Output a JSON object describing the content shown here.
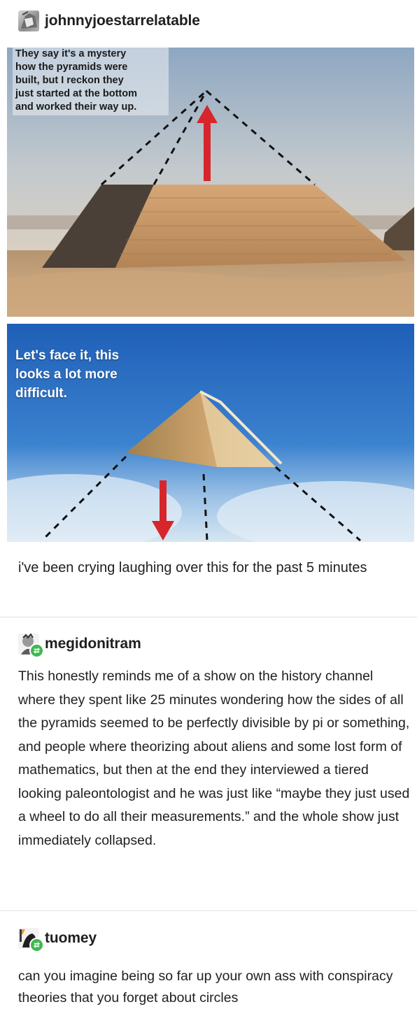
{
  "post": {
    "author": "johnnyjoestarrelatable",
    "image_top_caption": "They say it's a mystery\nhow the pyramids were\nbuilt, but I reckon they\njust started at the bottom\nand worked their way up.",
    "image_bottom_caption": "Let's face it, this\nlooks a lot more\ndifficult.",
    "body": "i've been crying laughing over this for the past 5 minutes"
  },
  "reblogs": [
    {
      "author": "megidonitram",
      "body": "This honestly reminds me of a show on the history channel where they spent like 25 minutes wondering how the sides of all the pyramids seemed to be perfectly divisible by pi or something, and people where theorizing about aliens and some lost form of mathematics, but then at the end they interviewed a tiered looking paleontologist and he was just like “maybe they just used a wheel to do all their measurements.” and the whole show just immediately collapsed."
    },
    {
      "author": "tuomey",
      "body": "can you imagine being so far up your own ass with conspiracy theories that you forget about circles"
    }
  ],
  "colors": {
    "arrow_red": "#d7262b",
    "sky_top": "#7a9cc0",
    "sky_blue": "#2f6fc0",
    "sand": "#c9a57a",
    "reblog_green": "#3fb950"
  },
  "icons": [
    "reblog-icon"
  ]
}
